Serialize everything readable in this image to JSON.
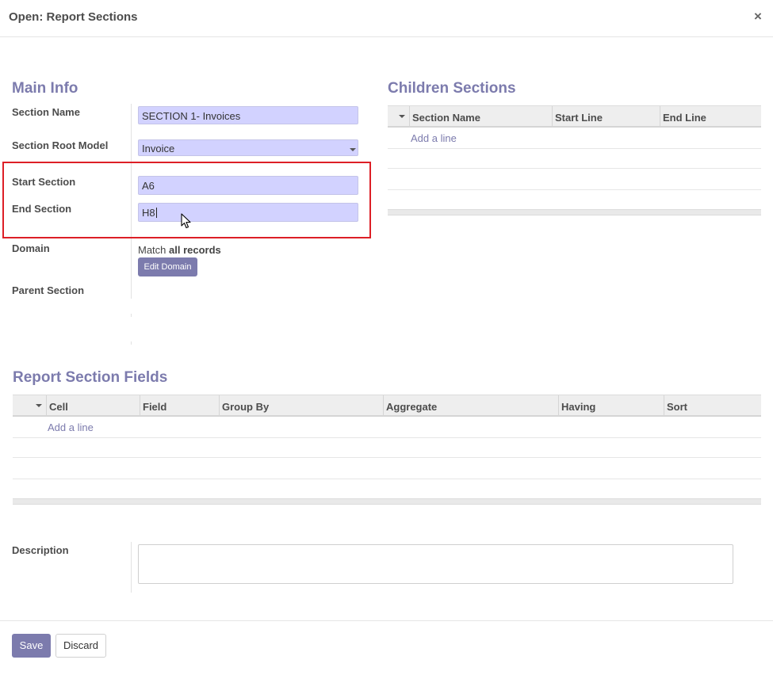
{
  "dialog": {
    "title": "Open: Report Sections",
    "close_glyph": "×"
  },
  "main_info": {
    "heading": "Main Info",
    "section_name": {
      "label": "Section Name",
      "value": "SECTION 1- Invoices"
    },
    "root_model": {
      "label": "Section Root Model",
      "value": "Invoice"
    },
    "start_section": {
      "label": "Start Section",
      "value": "A6"
    },
    "end_section": {
      "label": "End Section",
      "value": "H8"
    },
    "domain": {
      "label": "Domain",
      "match_prefix": "Match",
      "match_value": "all records",
      "edit_button": "Edit Domain"
    },
    "parent_section": {
      "label": "Parent Section"
    }
  },
  "children_sections": {
    "heading": "Children Sections",
    "columns": [
      "Section Name",
      "Start Line",
      "End Line"
    ],
    "add_line": "Add a line"
  },
  "report_fields": {
    "heading": "Report Section Fields",
    "columns": [
      "Cell",
      "Field",
      "Group By",
      "Aggregate",
      "Having",
      "Sort"
    ],
    "add_line": "Add a line"
  },
  "description": {
    "label": "Description",
    "value": ""
  },
  "footer": {
    "save": "Save",
    "discard": "Discard"
  },
  "colors": {
    "accent": "#7c7bad",
    "field_bg": "#d2d2ff",
    "highlight": "#dd1f26"
  }
}
